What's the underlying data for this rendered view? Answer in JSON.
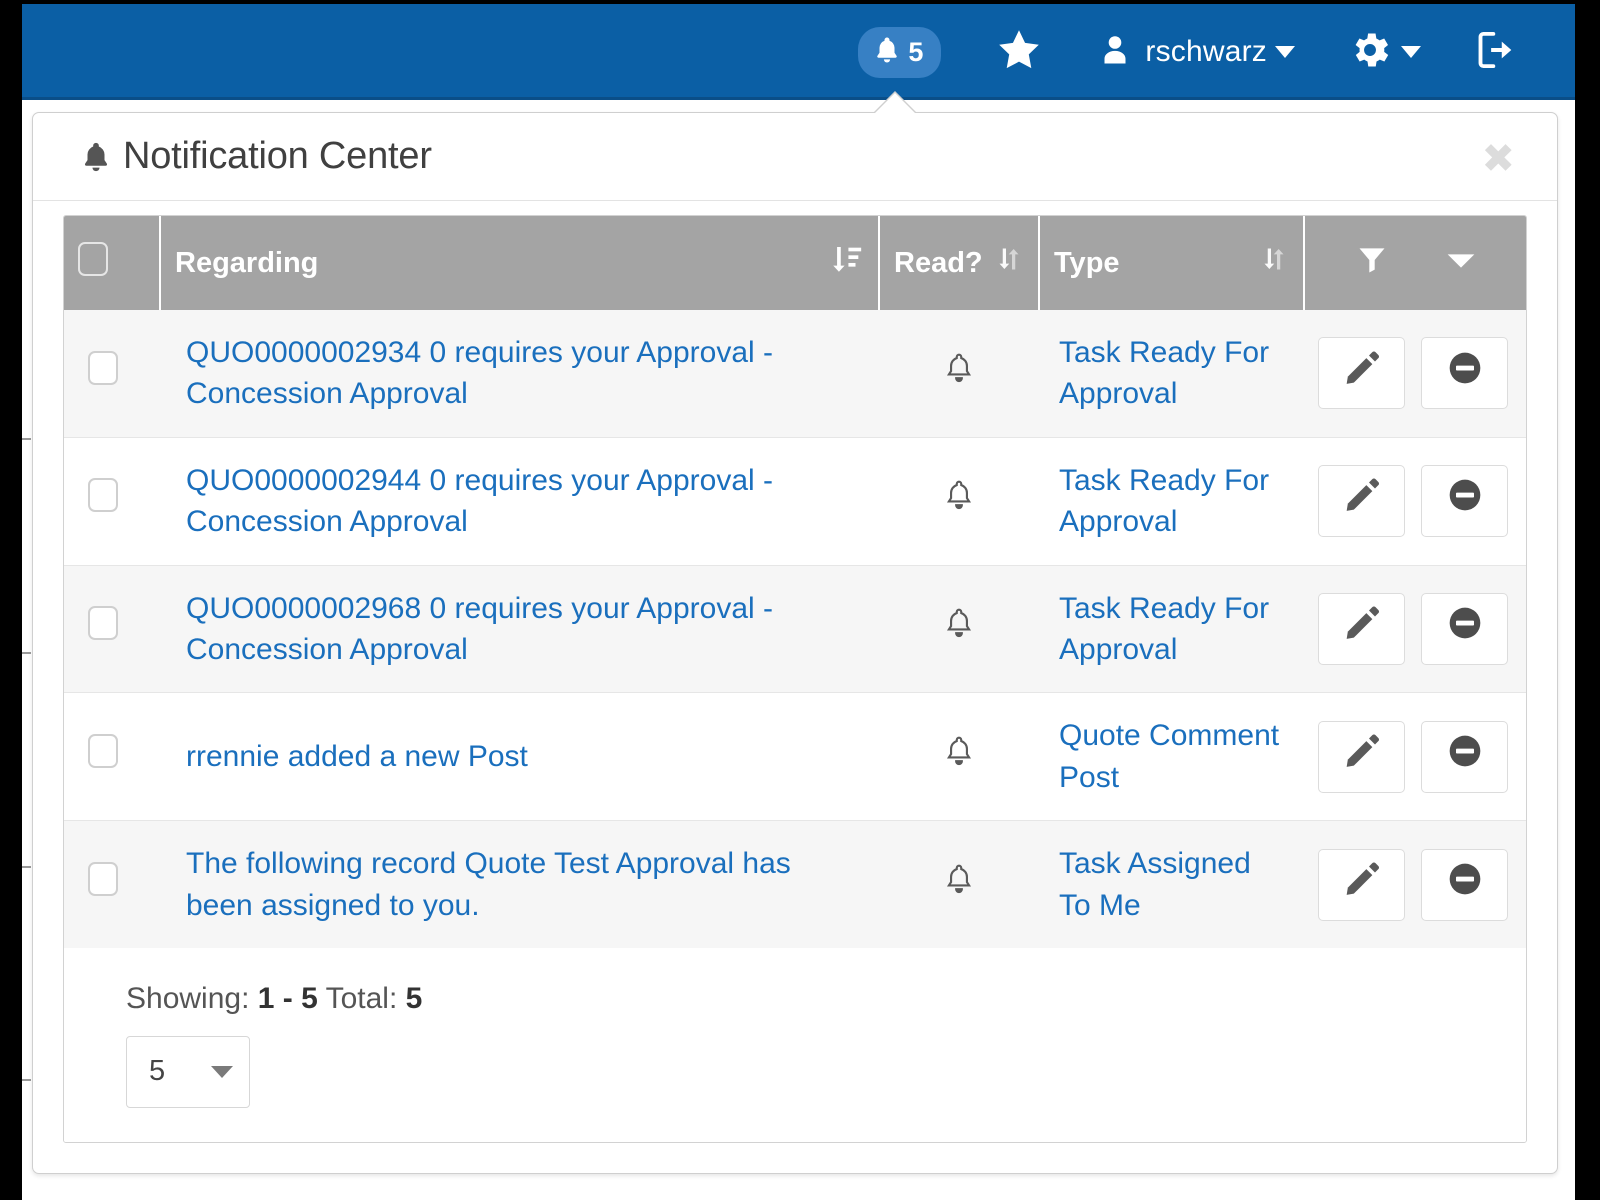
{
  "navbar": {
    "notifications": {
      "icon": "bell-icon",
      "count": "5"
    },
    "favorites": {
      "icon": "star-icon"
    },
    "user": {
      "icon": "user-icon",
      "name": "rschwarz",
      "caret": "caret-down-icon"
    },
    "settings": {
      "icon": "gear-icon",
      "caret": "caret-down-icon"
    },
    "logout": {
      "icon": "sign-out-icon"
    }
  },
  "panel": {
    "title": "Notification Center",
    "title_icon": "bell-icon",
    "close_label": "✖"
  },
  "table": {
    "columns": {
      "select_all": "",
      "regarding": "Regarding",
      "read": "Read?",
      "type": "Type",
      "actions": ""
    },
    "sort_icons": {
      "regarding": "sort-amount-desc-icon",
      "read": "sort-icon",
      "type": "sort-icon"
    },
    "header_tools": {
      "filter": "filter-icon",
      "menu": "caret-down-icon"
    },
    "rows": [
      {
        "regarding": "QUO0000002934 0 requires your Approval - Concession Approval",
        "read_icon": "bell-outline-icon",
        "type": "Task Ready For Approval",
        "edit_icon": "pencil-icon",
        "dismiss_icon": "minus-circle-icon"
      },
      {
        "regarding": "QUO0000002944 0 requires your Approval - Concession Approval",
        "read_icon": "bell-outline-icon",
        "type": "Task Ready For Approval",
        "edit_icon": "pencil-icon",
        "dismiss_icon": "minus-circle-icon"
      },
      {
        "regarding": "QUO0000002968 0 requires your Approval - Concession Approval",
        "read_icon": "bell-outline-icon",
        "type": "Task Ready For Approval",
        "edit_icon": "pencil-icon",
        "dismiss_icon": "minus-circle-icon"
      },
      {
        "regarding": "rrennie added a new Post",
        "read_icon": "bell-outline-icon",
        "type": "Quote Comment Post",
        "edit_icon": "pencil-icon",
        "dismiss_icon": "minus-circle-icon"
      },
      {
        "regarding": "The following record Quote Test Approval has been assigned to you.",
        "read_icon": "bell-outline-icon",
        "type": "Task Assigned To Me",
        "edit_icon": "pencil-icon",
        "dismiss_icon": "minus-circle-icon"
      }
    ]
  },
  "footer": {
    "showing_label": "Showing:",
    "showing_range": "1 - 5",
    "total_label": "Total:",
    "total_value": "5",
    "page_size_value": "5"
  },
  "colors": {
    "navbar_blue": "#0B5FA5",
    "badge_blue": "#3780C4",
    "link_blue": "#1a6fbd",
    "header_gray": "#a4a4a4",
    "row_alt": "#f6f6f6"
  }
}
